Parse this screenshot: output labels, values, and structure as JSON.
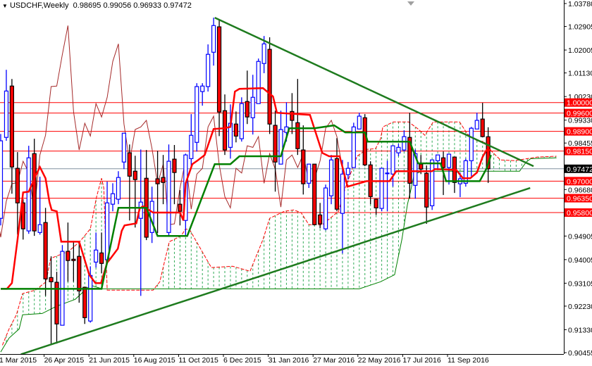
{
  "header": {
    "menu_icon": "triangle-down-icon",
    "symbol": "USDCHF,Weekly",
    "ohlc": "0.98695 0.99056 0.96933 0.97472"
  },
  "colors": {
    "bull": "#0000ff",
    "bear": "#ff0000",
    "tenkan": "#ff0000",
    "kijun": "#008000",
    "chikou": "#a52a2a",
    "span_upper": "#ff0000",
    "span_lower": "#008000",
    "cloud_hatch": "#2eaa55",
    "trendline": "#1e7b1e",
    "level": "#ff0000",
    "price_line": "#8090a0"
  },
  "chart_data": {
    "type": "candlestick",
    "title": "USDCHF,Weekly",
    "ylim": [
      0.90455,
      1.0378
    ],
    "x_unit": "week index",
    "y_ticks": [
      "1.03780",
      "1.02905",
      "1.02005",
      "1.01130",
      "1.00230",
      "0.99330",
      "0.98455",
      "0.96680",
      "0.94905",
      "0.94005",
      "0.93105",
      "0.92230",
      "0.91330",
      "0.90455"
    ],
    "x_ticks": [
      {
        "label": "1 Mar 2015",
        "week": 0
      },
      {
        "label": "26 Apr 2015",
        "week": 8
      },
      {
        "label": "21 Jun 2015",
        "week": 16
      },
      {
        "label": "16 Aug 2015",
        "week": 24
      },
      {
        "label": "11 Oct 2015",
        "week": 32
      },
      {
        "label": "6 Dec 2015",
        "week": 40
      },
      {
        "label": "31 Jan 2016",
        "week": 48
      },
      {
        "label": "27 Mar 2016",
        "week": 56
      },
      {
        "label": "22 May 2016",
        "week": 64
      },
      {
        "label": "17 Jul 2016",
        "week": 72
      },
      {
        "label": "11 Sep 2016",
        "week": 80
      }
    ],
    "candles_ohlc": [
      [
        0.9558,
        0.988,
        0.9531,
        0.9854
      ],
      [
        0.9867,
        1.0125,
        0.9854,
        1.0044
      ],
      [
        1.0063,
        1.009,
        0.9652,
        0.9754
      ],
      [
        0.9749,
        0.9811,
        0.9496,
        0.9617
      ],
      [
        0.9617,
        0.9631,
        0.9477,
        0.9518
      ],
      [
        0.951,
        0.9835,
        0.9499,
        0.9789
      ],
      [
        0.9805,
        0.9862,
        0.9491,
        0.951
      ],
      [
        0.9504,
        0.9717,
        0.9496,
        0.9534
      ],
      [
        0.9542,
        0.9598,
        0.9262,
        0.9327
      ],
      [
        0.9332,
        0.9413,
        0.908,
        0.9316
      ],
      [
        0.9314,
        0.9354,
        0.908,
        0.9155
      ],
      [
        0.915,
        0.9456,
        0.915,
        0.9432
      ],
      [
        0.9432,
        0.9542,
        0.9316,
        0.9397
      ],
      [
        0.9402,
        0.9472,
        0.9316,
        0.9397
      ],
      [
        0.9413,
        0.9464,
        0.9236,
        0.9281
      ],
      [
        0.9295,
        0.9295,
        0.9155,
        0.9179
      ],
      [
        0.9166,
        0.9375,
        0.916,
        0.934
      ],
      [
        0.9391,
        0.9504,
        0.937,
        0.9437
      ],
      [
        0.9426,
        0.9504,
        0.9348,
        0.9386
      ],
      [
        0.94,
        0.9698,
        0.9397,
        0.9617
      ],
      [
        0.9612,
        0.9692,
        0.9585,
        0.9652
      ],
      [
        0.9631,
        0.9738,
        0.9612,
        0.9714
      ],
      [
        0.9773,
        0.9883,
        0.9746,
        0.9883
      ],
      [
        0.9808,
        0.984,
        0.955,
        0.9719
      ],
      [
        0.9738,
        0.9797,
        0.9523,
        0.9706
      ],
      [
        0.9558,
        0.9821,
        0.9262,
        0.962
      ],
      [
        0.9711,
        0.9819,
        0.9475,
        0.9486
      ],
      [
        0.9504,
        0.9679,
        0.9464,
        0.9623
      ],
      [
        0.9709,
        0.9816,
        0.9502,
        0.969
      ],
      [
        0.9714,
        0.98,
        0.9612,
        0.9695
      ],
      [
        0.9504,
        0.984,
        0.9494,
        0.9776
      ],
      [
        0.9784,
        0.9838,
        0.9612,
        0.9733
      ],
      [
        0.9612,
        0.9666,
        0.9531,
        0.9585
      ],
      [
        0.955,
        0.9805,
        0.9491,
        0.98
      ],
      [
        0.9786,
        0.9956,
        0.9754,
        0.9875
      ],
      [
        0.9848,
        1.0074,
        0.9813,
        1.0061
      ],
      [
        1.0042,
        1.0074,
        0.9988,
        1.0063
      ],
      [
        1.0061,
        1.0222,
        1.0042,
        1.0184
      ],
      [
        1.0192,
        1.0324,
        1.0141,
        1.0294
      ],
      [
        1.0289,
        1.0316,
        0.9872,
        0.9964
      ],
      [
        0.9969,
        1.0031,
        0.98,
        0.9819
      ],
      [
        0.9829,
        0.9993,
        0.9786,
        0.9921
      ],
      [
        0.9918,
        0.9966,
        0.9848,
        0.9872
      ],
      [
        0.9862,
        1.002,
        0.9851,
        0.9996
      ],
      [
        1.0004,
        1.0122,
        0.9918,
        0.9945
      ],
      [
        0.9942,
        1.0106,
        0.9878,
        1.002
      ],
      [
        0.9996,
        1.0168,
        0.9996,
        1.0157
      ],
      [
        1.0149,
        1.0254,
        1.0112,
        1.0224
      ],
      [
        1.0203,
        1.0249,
        0.988,
        0.9918
      ],
      [
        0.9913,
        0.9969,
        0.966,
        0.9773
      ],
      [
        0.9765,
        0.9969,
        0.9765,
        0.9897
      ],
      [
        0.9886,
        1.0001,
        0.9851,
        0.9907
      ],
      [
        0.9966,
        1.0036,
        0.988,
        0.9932
      ],
      [
        0.9923,
        1.009,
        0.98,
        0.9824
      ],
      [
        0.9819,
        0.9913,
        0.9649,
        0.969
      ],
      [
        0.9692,
        0.9765,
        0.9674,
        0.9765
      ],
      [
        0.9765,
        0.9765,
        0.9531,
        0.9534
      ],
      [
        0.9571,
        0.9617,
        0.952,
        0.9537
      ],
      [
        0.9518,
        0.9687,
        0.9512,
        0.9674
      ],
      [
        0.9644,
        0.98,
        0.9612,
        0.9781
      ],
      [
        0.9786,
        0.9864,
        0.9585,
        0.9593
      ],
      [
        0.9577,
        0.9781,
        0.9424,
        0.9727
      ],
      [
        0.9725,
        0.9773,
        0.9706,
        0.9749
      ],
      [
        0.9752,
        0.9923,
        0.9752,
        0.9907
      ],
      [
        0.9899,
        0.9961,
        0.9897,
        0.9948
      ],
      [
        0.9942,
        0.9956,
        0.9757,
        0.9762
      ],
      [
        0.9762,
        0.9776,
        0.9612,
        0.9641
      ],
      [
        0.9631,
        0.9631,
        0.9571,
        0.9598
      ],
      [
        0.9596,
        0.9749,
        0.9585,
        0.9749
      ],
      [
        0.973,
        0.9778,
        0.9585,
        0.9731
      ],
      [
        0.9727,
        0.9835,
        0.9679,
        0.9835
      ],
      [
        0.9808,
        0.9843,
        0.9795,
        0.9829
      ],
      [
        0.9819,
        0.9894,
        0.9813,
        0.987
      ],
      [
        0.9867,
        0.9961,
        0.9633,
        0.9692
      ],
      [
        0.9684,
        0.9821,
        0.9633,
        0.9805
      ],
      [
        0.9765,
        0.98,
        0.9727,
        0.9746
      ],
      [
        0.973,
        0.976,
        0.9537,
        0.9601
      ],
      [
        0.9606,
        0.9781,
        0.959,
        0.9781
      ],
      [
        0.9778,
        0.98,
        0.9746,
        0.98
      ],
      [
        0.9789,
        0.9813,
        0.9647,
        0.9752
      ],
      [
        0.9752,
        0.9803,
        0.9687,
        0.9803
      ],
      [
        0.9792,
        0.9792,
        0.9655,
        0.9695
      ],
      [
        0.969,
        0.9733,
        0.9639,
        0.9709
      ],
      [
        0.9692,
        0.9786,
        0.9679,
        0.9778
      ],
      [
        0.9778,
        0.9907,
        0.9719,
        0.9902
      ],
      [
        0.9899,
        0.9961,
        0.9899,
        0.9932
      ],
      [
        0.9937,
        0.9999,
        0.9867,
        0.987
      ],
      [
        0.98695,
        0.99056,
        0.96933,
        0.97472
      ]
    ],
    "tenkan": [
      [
        0,
        0.9289
      ],
      [
        1.1,
        0.9289
      ],
      [
        2,
        0.9311
      ],
      [
        3,
        0.9477
      ],
      [
        4,
        0.9657
      ],
      [
        5,
        0.966
      ],
      [
        6.2,
        0.9719
      ],
      [
        7,
        0.9754
      ],
      [
        8,
        0.9711
      ],
      [
        8.7,
        0.962
      ],
      [
        9.1,
        0.959
      ],
      [
        10,
        0.9585
      ],
      [
        10.8,
        0.9469
      ],
      [
        14,
        0.9469
      ],
      [
        15.8,
        0.9343
      ],
      [
        16.9,
        0.9311
      ],
      [
        17.9,
        0.9311
      ],
      [
        19,
        0.9389
      ],
      [
        19.6,
        0.9405
      ],
      [
        20.9,
        0.9442
      ],
      [
        21.6,
        0.951
      ],
      [
        22.1,
        0.9531
      ],
      [
        24.2,
        0.9539
      ],
      [
        24.8,
        0.9596
      ],
      [
        25.4,
        0.9604
      ],
      [
        27.2,
        0.958
      ],
      [
        32,
        0.958
      ],
      [
        32.6,
        0.955
      ],
      [
        33,
        0.9692
      ],
      [
        34.2,
        0.9765
      ],
      [
        35.1,
        0.9778
      ],
      [
        36.4,
        0.98
      ],
      [
        38,
        0.9899
      ],
      [
        39.8,
        0.9902
      ],
      [
        41,
        0.9907
      ],
      [
        41.8,
        1.0042
      ],
      [
        42.6,
        1.0052
      ],
      [
        46.8,
        1.0055
      ],
      [
        48.6,
        1.0023
      ],
      [
        49.3,
        0.9961
      ],
      [
        55.2,
        0.9953
      ],
      [
        57.4,
        0.9808
      ],
      [
        58.6,
        0.9795
      ],
      [
        60.5,
        0.9795
      ],
      [
        61.9,
        0.9679
      ],
      [
        65.3,
        0.97
      ],
      [
        69.4,
        0.97
      ],
      [
        70.6,
        0.9738
      ],
      [
        77,
        0.9738
      ],
      [
        77.5,
        0.9746
      ],
      [
        81.3,
        0.9743
      ],
      [
        82.5,
        0.9711
      ],
      [
        83.8,
        0.9711
      ],
      [
        85,
        0.9733
      ],
      [
        86,
        0.9792
      ],
      [
        86.7,
        0.9819
      ],
      [
        87.5,
        0.9819
      ]
    ],
    "kijun": [
      [
        0,
        0.9289
      ],
      [
        18,
        0.9289
      ],
      [
        21,
        0.9598
      ],
      [
        26,
        0.9598
      ],
      [
        28,
        0.9491
      ],
      [
        33.3,
        0.9491
      ],
      [
        38.2,
        0.9765
      ],
      [
        41,
        0.9765
      ],
      [
        42.6,
        0.9795
      ],
      [
        50,
        0.9795
      ],
      [
        51.5,
        0.9902
      ],
      [
        56,
        0.9902
      ],
      [
        59.5,
        0.9913
      ],
      [
        61.5,
        0.9886
      ],
      [
        65,
        0.9886
      ],
      [
        65.5,
        0.9851
      ],
      [
        73,
        0.9851
      ],
      [
        74.5,
        0.9768
      ],
      [
        78.5,
        0.9768
      ],
      [
        79.5,
        0.97
      ],
      [
        85.5,
        0.97
      ],
      [
        86.8,
        0.9752
      ],
      [
        87.5,
        0.98
      ]
    ],
    "chikou_shift": 26,
    "span_upper": [
      [
        0.3,
        0.9074
      ],
      [
        1.5,
        0.9136
      ],
      [
        2.8,
        0.919
      ],
      [
        3.9,
        0.9271
      ],
      [
        6.2,
        0.9284
      ],
      [
        8.1,
        0.9316
      ],
      [
        8.9,
        0.9405
      ],
      [
        12.1,
        0.9432
      ],
      [
        14.1,
        0.9469
      ],
      [
        16,
        0.9518
      ],
      [
        17.1,
        0.9639
      ],
      [
        18,
        0.9711
      ],
      [
        18.4,
        0.9674
      ],
      [
        19,
        0.9284
      ],
      [
        27.2,
        0.9284
      ],
      [
        28.4,
        0.9316
      ],
      [
        29.2,
        0.9389
      ],
      [
        30.1,
        0.9469
      ],
      [
        32.2,
        0.9491
      ],
      [
        33,
        0.9518
      ],
      [
        33.8,
        0.9512
      ],
      [
        37.6,
        0.937
      ],
      [
        41.4,
        0.9375
      ],
      [
        44.5,
        0.9356
      ],
      [
        46.8,
        0.9477
      ],
      [
        48,
        0.9558
      ],
      [
        50.6,
        0.9585
      ],
      [
        52.3,
        0.959
      ],
      [
        53.6,
        0.958
      ],
      [
        55,
        0.9534
      ],
      [
        57.4,
        0.9534
      ],
      [
        60.3,
        0.9585
      ],
      [
        61.5,
        0.9674
      ],
      [
        63.6,
        0.9795
      ],
      [
        65.3,
        0.9821
      ],
      [
        66.9,
        0.9824
      ],
      [
        67.8,
        0.9862
      ],
      [
        68.2,
        0.9907
      ],
      [
        70.1,
        0.9926
      ],
      [
        72.8,
        0.9926
      ],
      [
        74.5,
        0.9899
      ],
      [
        75.7,
        0.9875
      ],
      [
        77.2,
        0.9926
      ],
      [
        81.9,
        0.9926
      ],
      [
        83.3,
        0.988
      ],
      [
        85,
        0.9854
      ],
      [
        86.3,
        0.9851
      ],
      [
        87,
        0.9827
      ],
      [
        89.2,
        0.9781
      ],
      [
        91.7,
        0.9778
      ],
      [
        95.8,
        0.9792
      ],
      [
        99.2,
        0.9795
      ]
    ],
    "span_lower": [
      [
        0,
        0.9048
      ],
      [
        0.5,
        0.9066
      ],
      [
        1.5,
        0.9101
      ],
      [
        3.3,
        0.9136
      ],
      [
        3.9,
        0.919
      ],
      [
        7.4,
        0.9195
      ],
      [
        9.9,
        0.9222
      ],
      [
        13.3,
        0.9249
      ],
      [
        16,
        0.9303
      ],
      [
        18.1,
        0.9289
      ],
      [
        64,
        0.9289
      ],
      [
        67.8,
        0.9316
      ],
      [
        70.3,
        0.9343
      ],
      [
        71.6,
        0.9477
      ],
      [
        72.6,
        0.9612
      ],
      [
        73.2,
        0.9666
      ],
      [
        73.8,
        0.9727
      ],
      [
        75.3,
        0.9738
      ],
      [
        92.6,
        0.9738
      ],
      [
        93.8,
        0.9773
      ],
      [
        94.6,
        0.9786
      ],
      [
        99.2,
        0.9789
      ]
    ],
    "trendlines": [
      {
        "name": "resistance",
        "from": [
          38.2,
          1.0324
        ],
        "to": [
          95.1,
          0.9757
        ]
      },
      {
        "name": "support",
        "from": [
          3.6,
          0.9039
        ],
        "to": [
          94.5,
          0.9674
        ]
      }
    ],
    "levels": [
      "1.00000",
      "0.99600",
      "0.98900",
      "0.98150",
      "0.97000",
      "0.96350",
      "0.95800"
    ],
    "current_price": "0.97472"
  }
}
